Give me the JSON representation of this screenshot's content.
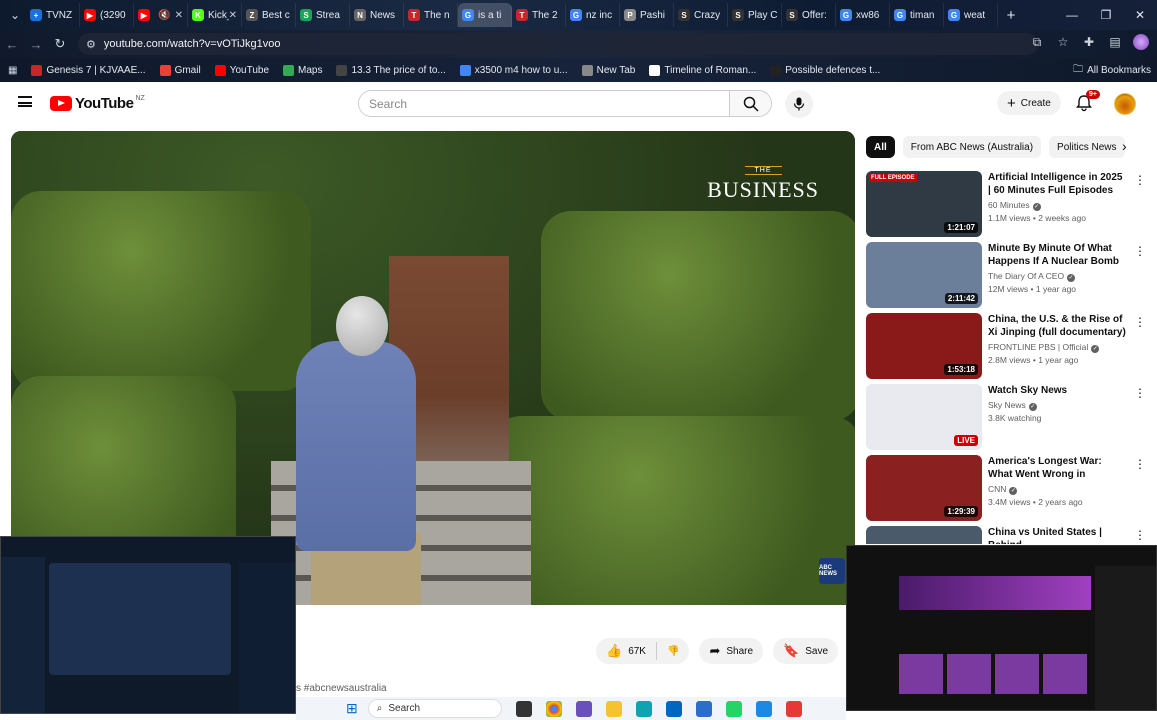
{
  "browser": {
    "tabs": [
      {
        "label": "TVNZ",
        "color": "#1e6fd9",
        "glyph": "+"
      },
      {
        "label": "(3290",
        "color": "#ff0000",
        "glyph": "▶"
      },
      {
        "label": "",
        "color": "#ff0000",
        "glyph": "▶"
      },
      {
        "label": "Kick_",
        "color": "#53fc18",
        "glyph": "K"
      },
      {
        "label": "Best c",
        "color": "#555555",
        "glyph": "Z"
      },
      {
        "label": "Strea",
        "color": "#18a558",
        "glyph": "S"
      },
      {
        "label": "News",
        "color": "#666666",
        "glyph": "N"
      },
      {
        "label": "The n",
        "color": "#c62828",
        "glyph": "T"
      },
      {
        "label": "is a ti",
        "color": "#4285f4",
        "glyph": "G"
      },
      {
        "label": "The 2",
        "color": "#c62828",
        "glyph": "T"
      },
      {
        "label": "nz inc",
        "color": "#4285f4",
        "glyph": "G"
      },
      {
        "label": "Pashi",
        "color": "#8a8a8a",
        "glyph": "P"
      },
      {
        "label": "Crazy",
        "color": "#333333",
        "glyph": "S"
      },
      {
        "label": "Play C",
        "color": "#333333",
        "glyph": "S"
      },
      {
        "label": "Offer:",
        "color": "#333333",
        "glyph": "S"
      },
      {
        "label": "xw86",
        "color": "#4285f4",
        "glyph": "G"
      },
      {
        "label": "timan",
        "color": "#4285f4",
        "glyph": "G"
      },
      {
        "label": "weat",
        "color": "#4285f4",
        "glyph": "G"
      }
    ],
    "url": "youtube.com/watch?v=vOTiJkg1voo",
    "bookmarks": [
      {
        "label": "Genesis 7 | KJVAAE...",
        "color": "#c62828"
      },
      {
        "label": "Gmail",
        "color": "#ea4335"
      },
      {
        "label": "YouTube",
        "color": "#ff0000"
      },
      {
        "label": "Maps",
        "color": "#34a853"
      },
      {
        "label": "13.3 The price of to...",
        "color": "#444444"
      },
      {
        "label": "x3500 m4 how to u...",
        "color": "#4285f4"
      },
      {
        "label": "New Tab",
        "color": "#888888"
      },
      {
        "label": "Timeline of Roman...",
        "color": "#ffffff"
      },
      {
        "label": "Possible defences t...",
        "color": "#222222"
      }
    ],
    "all_bookmarks": "All Bookmarks"
  },
  "youtube": {
    "logo_text": "YouTube",
    "country": "NZ",
    "search_placeholder": "Search",
    "create_label": "Create",
    "notifications": "9+",
    "watermark_the": "THE",
    "watermark_business": "BUSINESS",
    "likes": "67K",
    "share_label": "Share",
    "save_label": "Save",
    "hashtag": "s #abcnewsaustralia",
    "abc_badge": "ABC NEWS"
  },
  "chips": [
    "All",
    "From ABC News (Australia)",
    "Politics News"
  ],
  "recommendations": [
    {
      "title": "Artificial Intelligence in 2025 | 60 Minutes Full Episodes",
      "channel": "60 Minutes",
      "verified": true,
      "meta": "1.1M views • 2 weeks ago",
      "duration": "1:21:07",
      "badge": "FULL EPISODE",
      "thumb": "#2f3a44"
    },
    {
      "title": "Minute By Minute Of What Happens If A Nuclear Bomb ...",
      "channel": "The Diary Of A CEO",
      "verified": true,
      "meta": "12M views • 1 year ago",
      "duration": "2:11:42",
      "badge": "",
      "thumb": "#6b7f9a"
    },
    {
      "title": "China, the U.S. & the Rise of Xi Jinping (full documentary) | ...",
      "channel": "FRONTLINE PBS | Official",
      "verified": true,
      "meta": "2.8M views • 1 year ago",
      "duration": "1:53:18",
      "badge": "",
      "thumb": "#8a1a1a"
    },
    {
      "title": "Watch Sky News",
      "channel": "Sky News",
      "verified": true,
      "meta": "3.8K watching",
      "duration": "LIVE",
      "badge": "",
      "thumb": "#e8eaf0"
    },
    {
      "title": "America's Longest War: What Went Wrong in Afghanistan ...",
      "channel": "CNN",
      "verified": true,
      "meta": "3.4M views • 2 years ago",
      "duration": "1:29:39",
      "badge": "",
      "thumb": "#8a2020"
    },
    {
      "title": "China vs United States | Behind",
      "channel": "",
      "verified": false,
      "meta": "",
      "duration": "",
      "badge": "",
      "thumb": "#4a5a6a"
    }
  ],
  "taskbar": {
    "search_label": "Search"
  }
}
